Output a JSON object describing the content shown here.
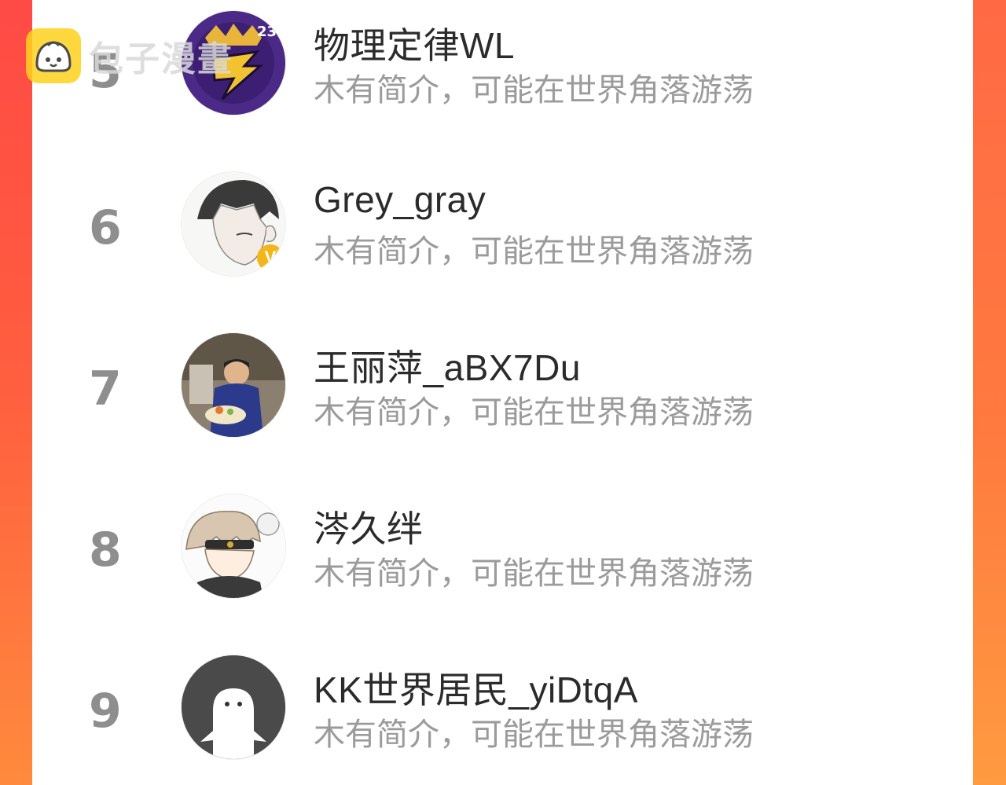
{
  "watermark": {
    "text": "包子漫畫",
    "icon": "bun-logo-icon"
  },
  "colors": {
    "accent": "#ff5a40",
    "rank": "#8e8e8e",
    "bio": "#9b9b9b",
    "name": "#2b2b2b"
  },
  "ranking": [
    {
      "rank": "5",
      "name": "物理定律WL",
      "bio": "木有简介，可能在世界角落游荡",
      "avatar_icon": "purple-emblem-avatar-icon"
    },
    {
      "rank": "6",
      "name": "Grey_gray",
      "bio": "木有简介，可能在世界角落游荡",
      "avatar_icon": "anime-boy-avatar-icon",
      "badge": "V"
    },
    {
      "rank": "7",
      "name": "王丽萍_aBX7Du",
      "bio": "木有简介，可能在世界角落游荡",
      "avatar_icon": "child-photo-avatar-icon"
    },
    {
      "rank": "8",
      "name": "涔久绊",
      "bio": "木有简介，可能在世界角落游荡",
      "avatar_icon": "chibi-character-avatar-icon"
    },
    {
      "rank": "9",
      "name": "KK世界居民_yiDtqA",
      "bio": "木有简介，可能在世界角落游荡",
      "avatar_icon": "default-ghost-avatar-icon"
    }
  ]
}
